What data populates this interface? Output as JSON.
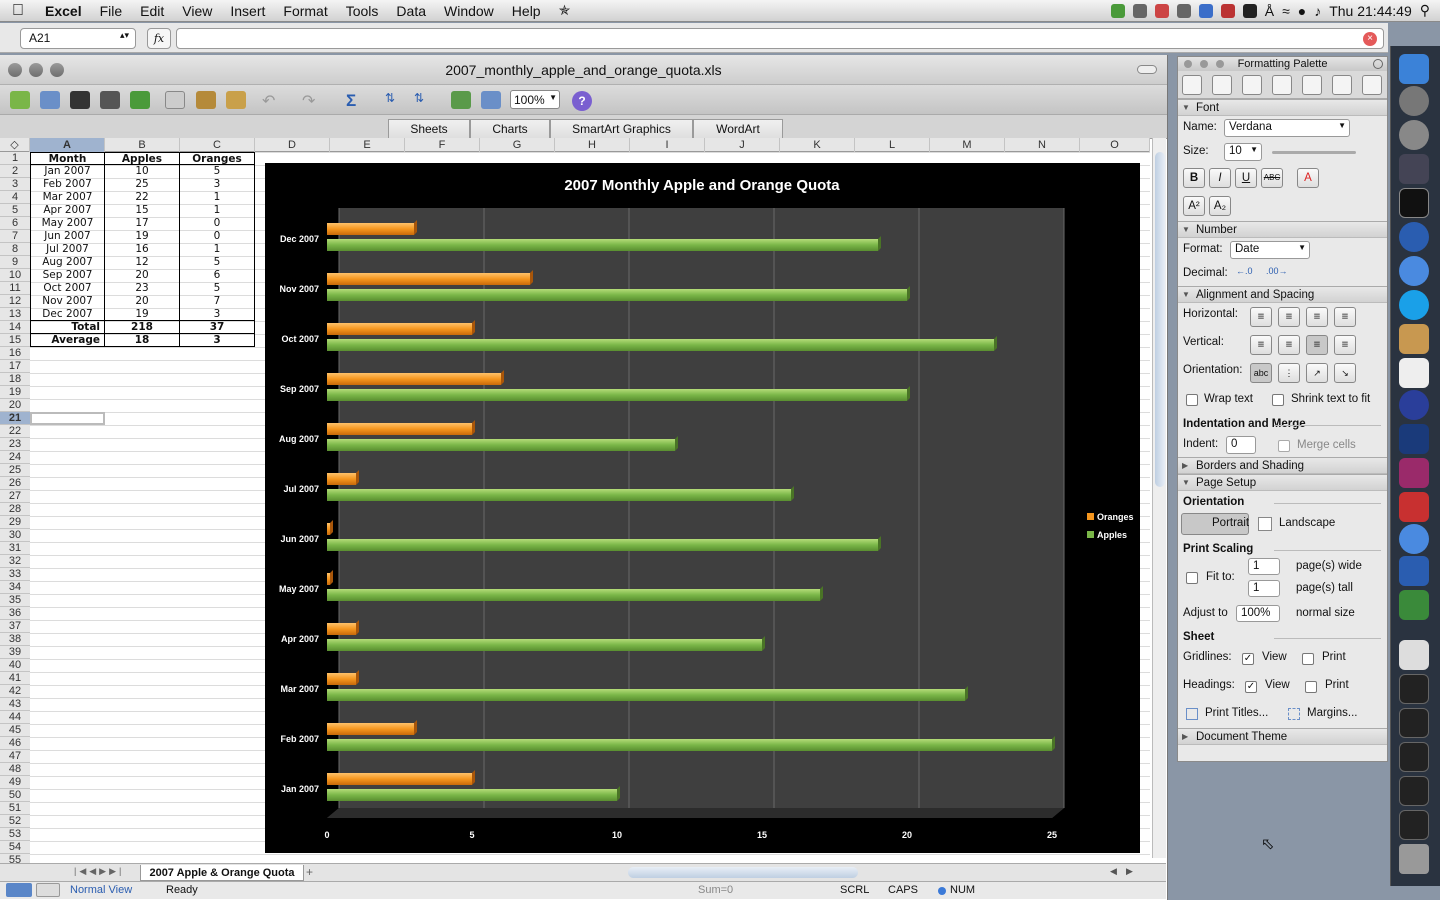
{
  "menubar": {
    "app": "Excel",
    "items": [
      "File",
      "Edit",
      "View",
      "Insert",
      "Format",
      "Tools",
      "Data",
      "Window",
      "Help"
    ],
    "clock": "Thu 21:44:49"
  },
  "formula_bar": {
    "name_box": "A21",
    "fx": "fx",
    "value": ""
  },
  "window": {
    "title": "2007_monthly_apple_and_orange_quota.xls",
    "zoom": "100%"
  },
  "ribbon_tabs": [
    "Sheets",
    "Charts",
    "SmartArt Graphics",
    "WordArt"
  ],
  "columns": [
    "A",
    "B",
    "C",
    "D",
    "E",
    "F",
    "G",
    "H",
    "I",
    "J",
    "K",
    "L",
    "M",
    "N",
    "O"
  ],
  "rows": [
    "1",
    "2",
    "3",
    "4",
    "5",
    "6",
    "7",
    "8",
    "9",
    "10",
    "11",
    "12",
    "13",
    "14",
    "15",
    "16",
    "17",
    "18",
    "19",
    "20",
    "21",
    "22",
    "23",
    "24",
    "25",
    "26",
    "27",
    "28",
    "29",
    "30",
    "31",
    "32",
    "33",
    "34",
    "35",
    "36",
    "37",
    "38",
    "39",
    "40",
    "41",
    "42",
    "43",
    "44",
    "45",
    "46",
    "47",
    "48",
    "49",
    "50",
    "51",
    "52",
    "53",
    "54",
    "55"
  ],
  "table": {
    "headers": [
      "Month",
      "Apples",
      "Oranges"
    ],
    "rows": [
      [
        "Jan 2007",
        "10",
        "5"
      ],
      [
        "Feb 2007",
        "25",
        "3"
      ],
      [
        "Mar 2007",
        "22",
        "1"
      ],
      [
        "Apr 2007",
        "15",
        "1"
      ],
      [
        "May 2007",
        "17",
        "0"
      ],
      [
        "Jun 2007",
        "19",
        "0"
      ],
      [
        "Jul 2007",
        "16",
        "1"
      ],
      [
        "Aug 2007",
        "12",
        "5"
      ],
      [
        "Sep 2007",
        "20",
        "6"
      ],
      [
        "Oct 2007",
        "23",
        "5"
      ],
      [
        "Nov 2007",
        "20",
        "7"
      ],
      [
        "Dec 2007",
        "19",
        "3"
      ]
    ],
    "total": [
      "Total",
      "218",
      "37"
    ],
    "average": [
      "Average",
      "18",
      "3"
    ]
  },
  "chart_data": {
    "type": "bar",
    "orientation": "horizontal",
    "title": "2007 Monthly Apple and Orange Quota",
    "categories": [
      "Jan 2007",
      "Feb 2007",
      "Mar 2007",
      "Apr 2007",
      "May 2007",
      "Jun 2007",
      "Jul 2007",
      "Aug 2007",
      "Sep 2007",
      "Oct 2007",
      "Nov 2007",
      "Dec 2007"
    ],
    "series": [
      {
        "name": "Apples",
        "values": [
          10,
          25,
          22,
          15,
          17,
          19,
          16,
          12,
          20,
          23,
          20,
          19
        ],
        "color": "#7ab648"
      },
      {
        "name": "Oranges",
        "values": [
          5,
          3,
          1,
          1,
          0,
          0,
          1,
          5,
          6,
          5,
          7,
          3
        ],
        "color": "#f5961e"
      }
    ],
    "xlim": [
      0,
      25
    ],
    "xticks": [
      "0",
      "5",
      "10",
      "15",
      "20",
      "25"
    ],
    "legend": [
      "Oranges",
      "Apples"
    ],
    "legend_position": "right",
    "grid": true
  },
  "sheet_tab": "2007 Apple & Orange Quota",
  "status": {
    "view": "Normal View",
    "state": "Ready",
    "sum": "Sum=0",
    "scrl": "SCRL",
    "caps": "CAPS",
    "num": "NUM"
  },
  "palette": {
    "title": "Formatting Palette",
    "font_section": "Font",
    "name_label": "Name:",
    "font_name": "Verdana",
    "size_label": "Size:",
    "font_size": "10",
    "number_section": "Number",
    "format_label": "Format:",
    "format_value": "Date",
    "decimal_label": "Decimal:",
    "align_section": "Alignment and Spacing",
    "horizontal_label": "Horizontal:",
    "vertical_label": "Vertical:",
    "orientation_label": "Orientation:",
    "wrap_text": "Wrap text",
    "shrink_text": "Shrink text to fit",
    "indent_header": "Indentation and Merge",
    "indent_label": "Indent:",
    "indent_value": "0",
    "merge_cells": "Merge cells",
    "borders_section": "Borders and Shading",
    "page_setup_section": "Page Setup",
    "orientation_header": "Orientation",
    "portrait": "Portrait",
    "landscape": "Landscape",
    "print_scaling_header": "Print Scaling",
    "fit_to": "Fit to:",
    "wide_value": "1",
    "wide_label": "page(s) wide",
    "tall_value": "1",
    "tall_label": "page(s) tall",
    "adjust_label": "Adjust to",
    "adjust_value": "100%",
    "normal_size": "normal size",
    "sheet_header": "Sheet",
    "gridlines_label": "Gridlines:",
    "headings_label": "Headings:",
    "view": "View",
    "print": "Print",
    "print_titles": "Print Titles...",
    "margins": "Margins...",
    "theme_section": "Document Theme"
  }
}
